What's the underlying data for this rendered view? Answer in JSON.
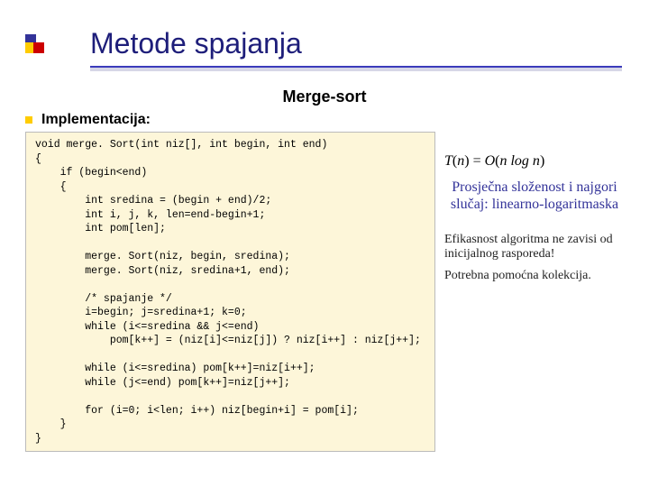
{
  "title": "Metode spajanja",
  "subtitle": "Merge-sort",
  "section_label": "Implementacija:",
  "code": "void merge. Sort(int niz[], int begin, int end)\n{\n    if (begin<end)\n    {\n        int sredina = (begin + end)/2;\n        int i, j, k, len=end-begin+1;\n        int pom[len];\n\n        merge. Sort(niz, begin, sredina);\n        merge. Sort(niz, sredina+1, end);\n\n        /* spajanje */\n        i=begin; j=sredina+1; k=0;\n        while (i<=sredina && j<=end)\n            pom[k++] = (niz[i]<=niz[j]) ? niz[i++] : niz[j++];\n\n        while (i<=sredina) pom[k++]=niz[i++];\n        while (j<=end) pom[k++]=niz[j++];\n\n        for (i=0; i<len; i++) niz[begin+i] = pom[i];\n    }\n}",
  "formula_lhs": "T",
  "formula_arg": "n",
  "formula_eq": " = ",
  "formula_O": "O",
  "formula_inner": "n log n",
  "avg_case": "Prosječna složenost i najgori slučaj: linearno-logaritmaska",
  "note1": "Efikasnost algoritma ne zavisi od inicijalnog rasporeda!",
  "note2": "Potrebna pomoćna kolekcija."
}
